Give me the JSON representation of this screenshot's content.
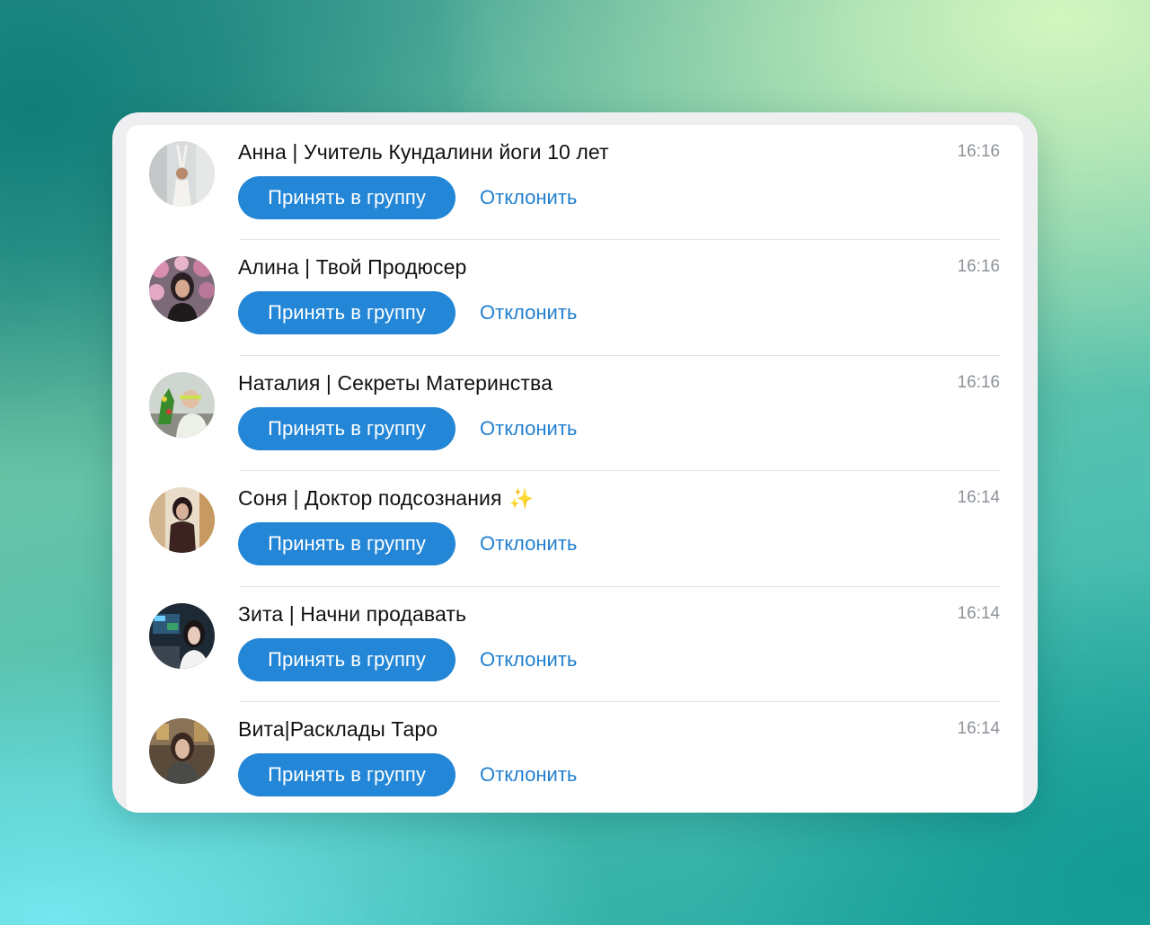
{
  "requests": [
    {
      "name": "Анна | Учитель Кундалини йоги 10 лет",
      "emoji": "",
      "time": "16:16",
      "accept_label": "Принять в группу",
      "decline_label": "Отклонить"
    },
    {
      "name": "Алина | Твой Продюсер",
      "emoji": "",
      "time": "16:16",
      "accept_label": "Принять в группу",
      "decline_label": "Отклонить"
    },
    {
      "name": "Наталия | Секреты Материнства",
      "emoji": "",
      "time": "16:16",
      "accept_label": "Принять в группу",
      "decline_label": "Отклонить"
    },
    {
      "name": "Соня | Доктор подсознания",
      "emoji": "✨",
      "time": "16:14",
      "accept_label": "Принять в группу",
      "decline_label": "Отклонить"
    },
    {
      "name": "Зита | Начни продавать",
      "emoji": "",
      "time": "16:14",
      "accept_label": "Принять в группу",
      "decline_label": "Отклонить"
    },
    {
      "name": "Вита|Расклады Таро",
      "emoji": "",
      "time": "16:14",
      "accept_label": "Принять в группу",
      "decline_label": "Отклонить"
    }
  ],
  "colors": {
    "accent": "#2386d6",
    "link": "#2380cf",
    "time": "#8d9298"
  }
}
